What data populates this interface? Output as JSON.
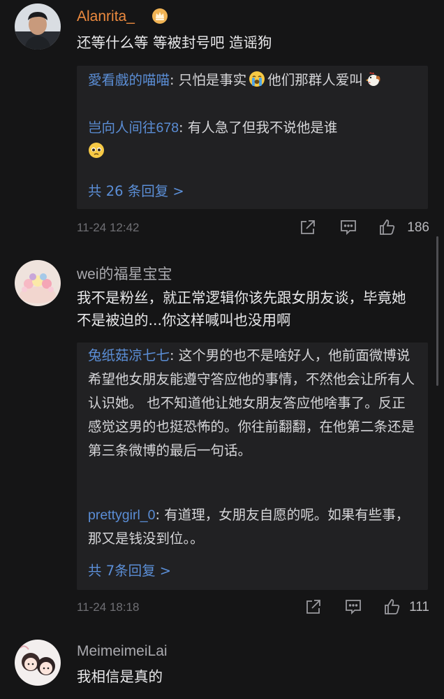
{
  "comments": [
    {
      "username": "Alanrita_",
      "badge_icon": "crown-icon",
      "text": "还等什么等 等被封号吧 造谣狗",
      "replies": [
        {
          "name": "愛看戲的喵喵",
          "text_before_emoji": ": 只怕是事实",
          "emoji_1": "crying-face-emoji",
          "text_middle": "他们那群人爱叫",
          "emoji_2": "rooster-emoji"
        },
        {
          "name": "岂向人间往678",
          "text": ": 有人急了但我不说他是谁",
          "emoji": "pleading-face-emoji"
        }
      ],
      "more_replies": "共 26 条回复 >",
      "timestamp": "11-24 12:42",
      "likes": "186"
    },
    {
      "username": "wei的福星宝宝",
      "text": "我不是粉丝，就正常逻辑你该先跟女朋友谈，毕竟她不是被迫的...你这样喊叫也没用啊",
      "replies": [
        {
          "name": "兔纸菇凉七七",
          "text": ": 这个男的也不是啥好人，他前面微博说希望他女朋友能遵守答应他的事情，不然他会让所有人认识她。 也不知道他让她女朋友答应他啥事了。反正感觉这男的也挺恐怖的。你往前翻翻，在他第二条还是第三条微博的最后一句话。"
        },
        {
          "name": "prettygirl_0",
          "text": ": 有道理，女朋友自愿的呢。如果有些事，那又是钱没到位。。"
        }
      ],
      "more_replies": "共 7条回复 >",
      "timestamp": "11-24 18:18",
      "likes": "111"
    },
    {
      "username": "MeimeimeiLai",
      "text": "我相信是真的"
    }
  ],
  "icons": {
    "share": "share-icon",
    "reply": "comment-icon",
    "like": "thumbs-up-icon"
  },
  "colors": {
    "background": "#151516",
    "reply_box": "#212123",
    "link_blue": "#5b8ed6",
    "vip_orange": "#ed8a3f",
    "text": "#e8e8ea",
    "muted": "#6f6f74"
  }
}
